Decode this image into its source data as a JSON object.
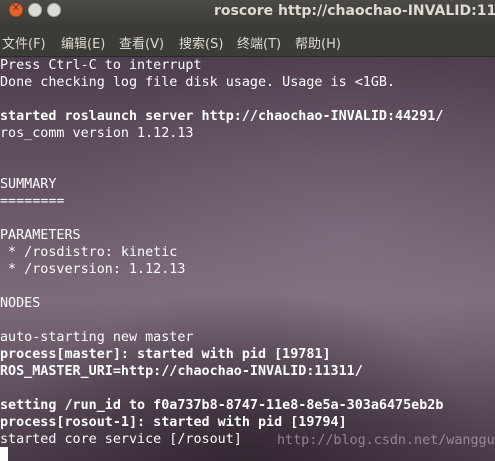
{
  "window": {
    "title": "roscore http://chaochao-INVALID:11311/",
    "close_glyph": "✕"
  },
  "menu": [
    "文件(F)",
    "编辑(E)",
    "查看(V)",
    "搜索(S)",
    "终端(T)",
    "帮助(H)"
  ],
  "terminal": {
    "lines": [
      "Press Ctrl-C to interrupt",
      "Done checking log file disk usage. Usage is <1GB.",
      "",
      "started roslaunch server http://chaochao-INVALID:44291/",
      "ros_comm version 1.12.13",
      "",
      "",
      "SUMMARY",
      "========",
      "",
      "PARAMETERS",
      " * /rosdistro: kinetic",
      " * /rosversion: 1.12.13",
      "",
      "NODES",
      "",
      "auto-starting new master",
      "process[master]: started with pid [19781]",
      "ROS_MASTER_URI=http://chaochao-INVALID:11311/",
      "",
      "setting /run_id to f0a737b8-8747-11e8-8e5a-303a6475eb2b",
      "process[rosout-1]: started with pid [19794]",
      "started core service [/rosout]"
    ],
    "watermark": "http://blog.csdn.net/wangguchao"
  },
  "colors": {
    "text": "#ffffff",
    "titlebar": "#3c3b37",
    "close_button": "#e8632c"
  }
}
